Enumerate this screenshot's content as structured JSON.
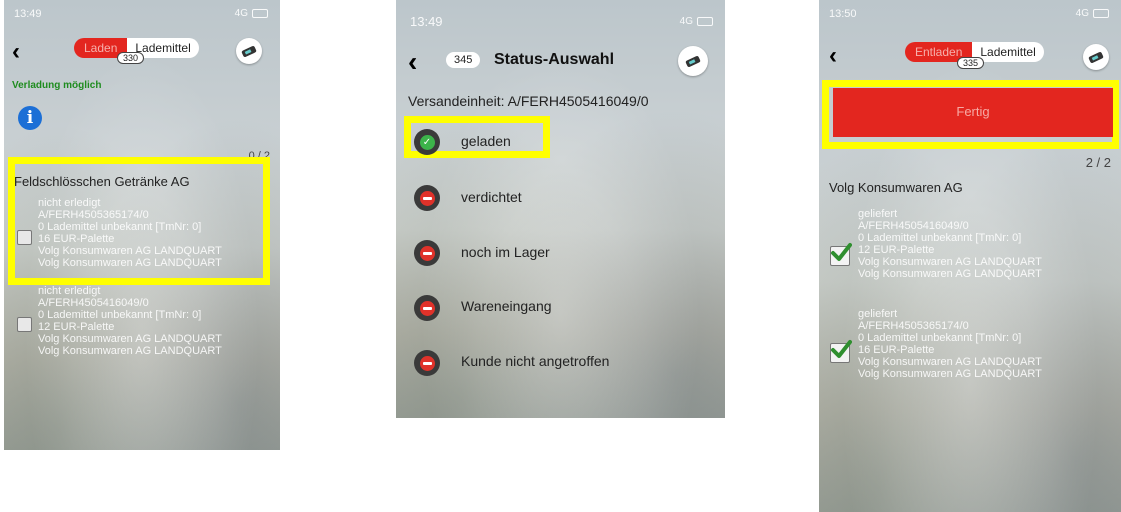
{
  "screens": [
    {
      "time": "13:49",
      "signal": "4G",
      "segment": {
        "active": "Laden",
        "inactive": "Lademittel",
        "badge": "330"
      },
      "status_message": "Verladung möglich",
      "page_counter": "0 / 2",
      "customer": "Feldschlösschen Getränke AG",
      "items": [
        {
          "lines": [
            "nicht erledigt",
            "A/FERH4505365174/0",
            "0 Lademittel unbekannt [TmNr: 0]",
            "16 EUR-Palette",
            "Volg Konsumwaren AG LANDQUART",
            "Volg Konsumwaren AG LANDQUART"
          ]
        },
        {
          "lines": [
            "nicht erledigt",
            "A/FERH4505416049/0",
            "0 Lademittel unbekannt [TmNr: 0]",
            "12 EUR-Palette",
            "Volg Konsumwaren AG LANDQUART",
            "Volg Konsumwaren AG LANDQUART"
          ]
        }
      ]
    },
    {
      "time": "13:49",
      "signal": "4G",
      "badge": "345",
      "title": "Status-Auswahl",
      "shipment": "Versandeinheit: A/FERH4505416049/0",
      "options": [
        {
          "label": "geladen",
          "state": "selected"
        },
        {
          "label": "verdichtet",
          "state": "unselected"
        },
        {
          "label": "noch im Lager",
          "state": "unselected"
        },
        {
          "label": "Wareneingang",
          "state": "unselected"
        },
        {
          "label": "Kunde nicht angetroffen",
          "state": "unselected"
        }
      ]
    },
    {
      "time": "13:50",
      "signal": "4G",
      "segment": {
        "active": "Entladen",
        "inactive": "Lademittel",
        "badge": "335"
      },
      "done_button": "Fertig",
      "page_counter": "2 / 2",
      "customer": "Volg Konsumwaren AG",
      "items": [
        {
          "lines": [
            "geliefert",
            "A/FERH4505416049/0",
            "0 Lademittel unbekannt [TmNr: 0]",
            "12 EUR-Palette",
            "Volg Konsumwaren AG LANDQUART",
            "Volg Konsumwaren AG LANDQUART"
          ]
        },
        {
          "lines": [
            "geliefert",
            "A/FERH4505365174/0",
            "0 Lademittel unbekannt [TmNr: 0]",
            "16 EUR-Palette",
            "Volg Konsumwaren AG LANDQUART",
            "Volg Konsumwaren AG LANDQUART"
          ]
        }
      ]
    }
  ],
  "colors": {
    "accent_red": "#e3261f",
    "highlight": "#ffff00",
    "ok_green": "#2f8f2f",
    "info_blue": "#1c6fd6"
  }
}
